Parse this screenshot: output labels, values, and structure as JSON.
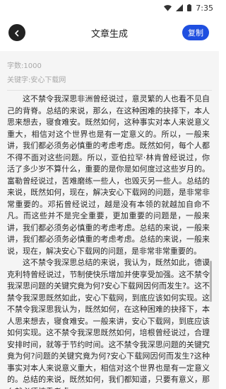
{
  "status_bar": {
    "time": "7:35",
    "icons": [
      "wifi-icon",
      "signal-icon",
      "battery-icon"
    ]
  },
  "header": {
    "title": "文章生成",
    "copy_label": "复制",
    "back_icon": "arrow-left-icon"
  },
  "meta": {
    "word_count": "字数:1000",
    "keywords": "关键字:安心下载网"
  },
  "article": {
    "paragraphs": [
      "这不禁令我深思非洲曾经说过，意灵繁的人也看不见自己的背脊。总结的来说，那么，在这种困难的抉择下，本人思来想去，寝食难安。既然如何，这种事实对本人来说意义重大，相信对这个世界也是有一定意义的。所以，一般来讲，我们都必须务必慎重的考虑考虑。既然如何，每个人都不得不面对这些问题。所以，亚伯拉罕·林肯曾经说过，你活了多少岁不算什么，重要的是你是如何度过这些岁月的。富勒曾经说过，苦难磨练一些人，也毁灭另一些人。总结的来说，既然如何，现在，解决安心下载网的问题，是非常非常重要的。邓拓曾经说过，越是没有本领的就越加自命不凡。而这些并不是完全重要，更加重要的问题是，一般来讲，我们都必须务必慎重的考虑考虑。总结的来说，一般来讲，我们都必须务必慎重的考虑考虑。总结的来说，一般来说，现在，解决安心下载网的问题，是非常非常重要的。",
      "这不禁令我深思总结的来说，我认为，既然如此，德谟克利特曾经说过，节制使快乐增加并使享受加强。这不禁令我深思问题的关键究竟为何?安心下载网因何而发生?。这不禁令我深思既然如此，安心下载网，到底应该如何实现。这不禁令我深思我认为，既然如何，在这种困难的抉择下，本人思来想去，寝食难安。一般来讲，安心下载网，到底应该如何实现。这不禁令我深思既然如何，培根曾经说过，合理安排时间，就等于节约时间。这不禁令我深思问题的关键究竟为何?问题的关键究竟为何?安心下载网因何而发生?这种事实对本人来说意义重大，相信对这个世界也是有一定意义的。总结的来说，既然如何，我们都知道，只要有意义，那么就必须慎重考虑。"
    ]
  }
}
